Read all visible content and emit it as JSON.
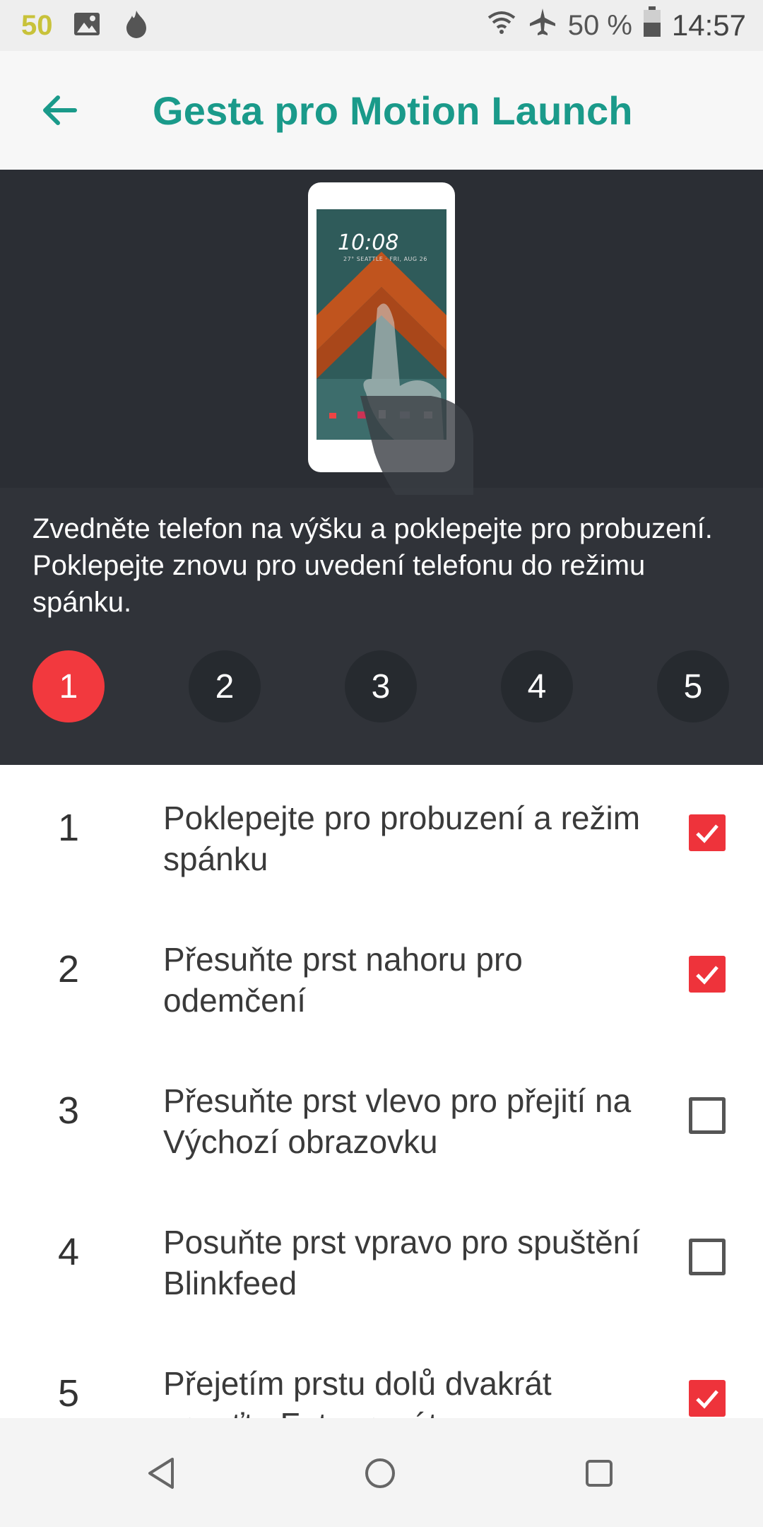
{
  "status_bar": {
    "notification_count": "50",
    "battery_percent": "50 %",
    "time": "14:57",
    "icons": [
      "image-icon",
      "flame-icon",
      "wifi-icon",
      "airplane-icon",
      "battery-icon"
    ]
  },
  "app_bar": {
    "title": "Gesta pro Motion Launch",
    "back_icon": "arrow-back-icon"
  },
  "illustration": {
    "clock_time": "10:08",
    "clock_sub": "27° SEATTLE · FRI, AUG 26"
  },
  "description": "Zvedněte telefon na výšku a poklepejte pro probuzení. Poklepejte znovu pro uvedení telefonu do režimu spánku.",
  "steps": {
    "items": [
      "1",
      "2",
      "3",
      "4",
      "5"
    ],
    "active": "1"
  },
  "gestures": [
    {
      "num": "1",
      "label": "Poklepejte pro probuzení a režim spánku",
      "checked": true
    },
    {
      "num": "2",
      "label": "Přesuňte prst nahoru pro odemčení",
      "checked": true
    },
    {
      "num": "3",
      "label": "Přesuňte prst vlevo pro přejití na Výchozí obrazovku",
      "checked": false
    },
    {
      "num": "4",
      "label": "Posuňte prst vpravo pro spuštění Blinkfeed",
      "checked": false
    },
    {
      "num": "5",
      "label": "Přejetím prstu dolů dvakrát spusťte Fotoaparát",
      "checked": true
    }
  ],
  "colors": {
    "accent_teal": "#1a9a8a",
    "accent_red": "#ee333b",
    "panel_dark": "#2a2d33"
  },
  "nav_bar": [
    "back-triangle-icon",
    "home-circle-icon",
    "recents-square-icon"
  ]
}
